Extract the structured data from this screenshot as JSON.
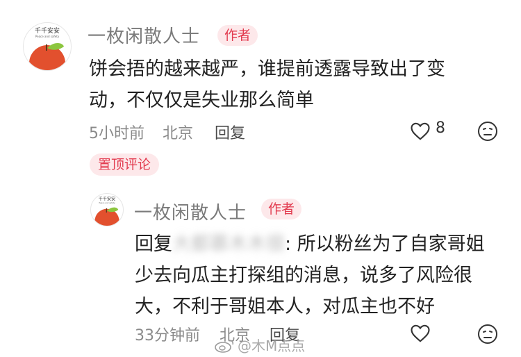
{
  "avatar": {
    "title_text": "千千安安",
    "subtitle_text": "Peace and safety"
  },
  "top_comment": {
    "username": "一枚闲散人士",
    "author_badge": "作者",
    "text_line1": "饼会捂的越来越严，谁提前透露导致出了变",
    "text_line2": "动，不仅仅是失业那么简单",
    "time": "5小时前",
    "location": "北京",
    "reply_label": "回复",
    "like_count": "8",
    "pinned_badge": "置顶评论"
  },
  "reply_comment": {
    "username": "一枚闲散人士",
    "author_badge": "作者",
    "reply_prefix": "回复",
    "replied_user_obscured": "大都慕木木很",
    "text_line1_after_name": ": 所以粉丝为了自家哥姐",
    "text_line2": "少去向瓜主打探组的消息，说多了风险很",
    "text_line3": "大，不利于哥姐本人，对瓜主也不好",
    "time": "33分钟前",
    "location": "北京",
    "reply_label": "回复"
  },
  "watermark": {
    "text": "@木M点点"
  },
  "colors": {
    "accent": "#e23a4e",
    "badge_bg": "#fde8ea",
    "apple": "#e2502e",
    "leaf": "#8cc63f"
  }
}
